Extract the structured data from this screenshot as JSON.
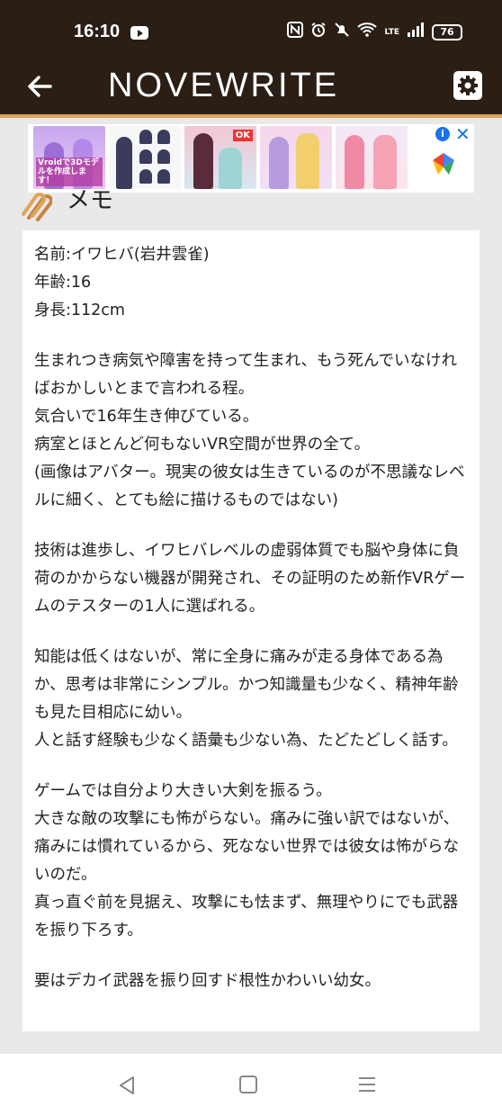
{
  "status_bar": {
    "time": "16:10",
    "battery": "76",
    "network": "LTE",
    "icons": [
      "youtube-icon",
      "nfc-icon",
      "alarm-icon",
      "mute-icon",
      "wifi-icon",
      "signal-icon",
      "battery-icon"
    ]
  },
  "header": {
    "title": "NOVEWRITE",
    "back_icon": "arrow-left-icon",
    "settings_icon": "gear-icon"
  },
  "ad": {
    "thumb1_label": "Vroidで3Dモデルを作成します！",
    "thumb3_badge": "OK",
    "info_glyph": "i",
    "close_glyph": "✕"
  },
  "memo": {
    "title": "メモ",
    "paragraphs": [
      "名前:イワヒバ(岩井雲雀)\n年齢:16\n身長:112cm",
      "生まれつき病気や障害を持って生まれ、もう死んでいなければおかしいとまで言われる程。\n気合いで16年生き伸びている。\n病室とほとんど何もないVR空間が世界の全て。\n(画像はアバター。現実の彼女は生きているのが不思議なレベルに細く、とても絵に描けるものではない)",
      "技術は進歩し、イワヒバレベルの虚弱体質でも脳や身体に負荷のかからない機器が開発され、その証明のため新作VRゲームのテスターの1人に選ばれる。",
      "知能は低くはないが、常に全身に痛みが走る身体である為か、思考は非常にシンプル。かつ知識量も少なく、精神年齢も見た目相応に幼い。\n人と話す経験も少なく語彙も少ない為、たどたどしく話す。",
      "ゲームでは自分より大きい大剣を振るう。\n大きな敵の攻撃にも怖がらない。痛みに強い訳ではないが、痛みには慣れているから、死なない世界では彼女は怖がらないのだ。\n真っ直ぐ前を見据え、攻撃にも怯まず、無理やりにでも武器を振り下ろす。",
      "要はデカイ武器を振り回すド根性かわいい幼女。"
    ]
  },
  "colors": {
    "header_bg": "#2b1f15",
    "accent": "#e0a35a",
    "page_bg": "#e9e9e9"
  }
}
